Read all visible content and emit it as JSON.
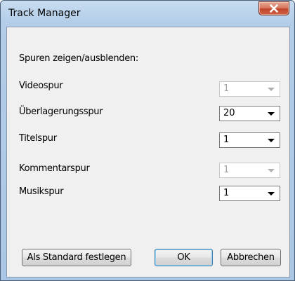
{
  "window": {
    "title": "Track Manager"
  },
  "titlebar": {
    "close_icon": "close-x-icon"
  },
  "section": {
    "heading": "Spuren zeigen/ausblenden:"
  },
  "tracks": [
    {
      "label": "Videospur",
      "value": "1",
      "enabled": false
    },
    {
      "label": "Überlagerungsspur",
      "value": "20",
      "enabled": true
    },
    {
      "label": "Titelspur",
      "value": "1",
      "enabled": true
    },
    {
      "label": "Kommentarspur",
      "value": "1",
      "enabled": false
    },
    {
      "label": "Musikspur",
      "value": "1",
      "enabled": true
    }
  ],
  "buttons": {
    "set_default": "Als Standard festlegen",
    "ok": "OK",
    "cancel": "Abbrechen"
  },
  "colors": {
    "close_button": "#c2452b",
    "default_button_border": "#3c7fb1"
  }
}
